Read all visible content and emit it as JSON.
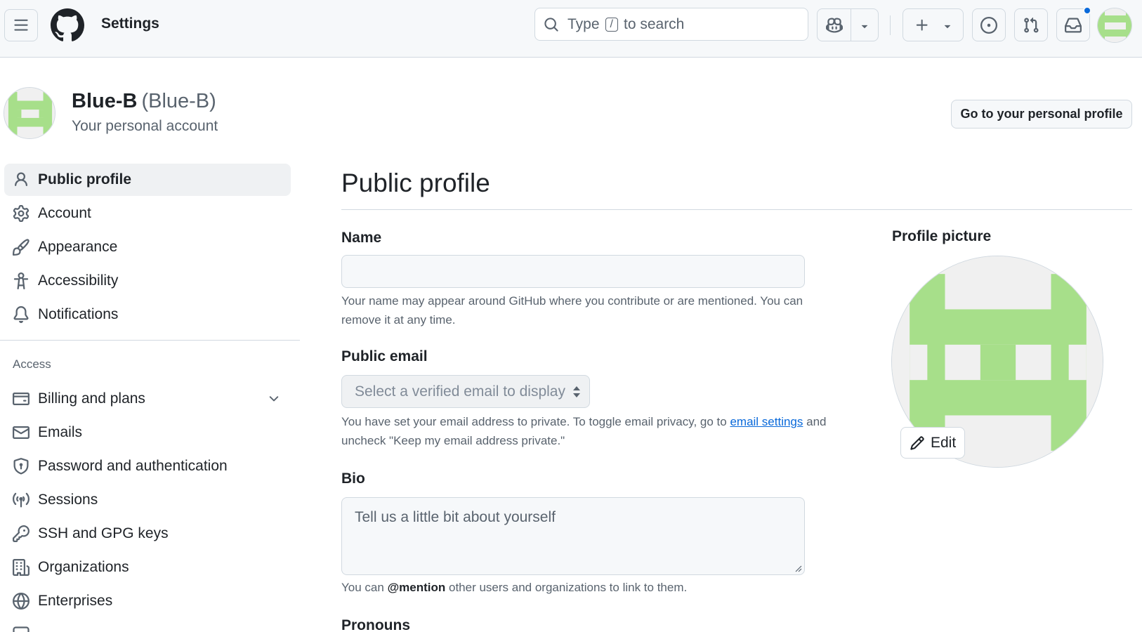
{
  "header": {
    "title": "Settings",
    "search": {
      "prefix": "Type",
      "key": "/",
      "suffix": "to search"
    }
  },
  "account": {
    "name": "Blue-B",
    "login": "(Blue-B)",
    "subtitle": "Your personal account",
    "profile_button": "Go to your personal profile"
  },
  "sidebar": {
    "items": [
      {
        "label": "Public profile",
        "icon": "person-icon",
        "active": true
      },
      {
        "label": "Account",
        "icon": "gear-icon"
      },
      {
        "label": "Appearance",
        "icon": "paintbrush-icon"
      },
      {
        "label": "Accessibility",
        "icon": "accessibility-icon"
      },
      {
        "label": "Notifications",
        "icon": "bell-icon"
      }
    ],
    "group_title": "Access",
    "access_items": [
      {
        "label": "Billing and plans",
        "icon": "credit-card-icon",
        "expandable": true
      },
      {
        "label": "Emails",
        "icon": "mail-icon"
      },
      {
        "label": "Password and authentication",
        "icon": "shield-lock-icon"
      },
      {
        "label": "Sessions",
        "icon": "broadcast-icon"
      },
      {
        "label": "SSH and GPG keys",
        "icon": "key-icon"
      },
      {
        "label": "Organizations",
        "icon": "organization-icon"
      },
      {
        "label": "Enterprises",
        "icon": "globe-icon"
      }
    ]
  },
  "main": {
    "title": "Public profile",
    "name": {
      "label": "Name",
      "value": "",
      "note": "Your name may appear around GitHub where you contribute or are mentioned. You can remove it at any time."
    },
    "email": {
      "label": "Public email",
      "selected": "Select a verified email to display",
      "note_before": "You have set your email address to private. To toggle email privacy, go to",
      "note_link": "email settings",
      "note_after": "and uncheck \"Keep my email address private.\""
    },
    "bio": {
      "label": "Bio",
      "placeholder": "Tell us a little bit about yourself",
      "note_before": "You can",
      "note_mention": "@mention",
      "note_after": "other users and organizations to link to them."
    },
    "pronouns": {
      "label": "Pronouns"
    }
  },
  "profile_picture": {
    "label": "Profile picture",
    "edit_label": "Edit",
    "avatar_color": "#a7df8a",
    "avatar_bg": "#f0f0f0"
  },
  "colors": {
    "accent": "#0969da",
    "border": "#d1d9e0",
    "muted": "#59636e"
  }
}
